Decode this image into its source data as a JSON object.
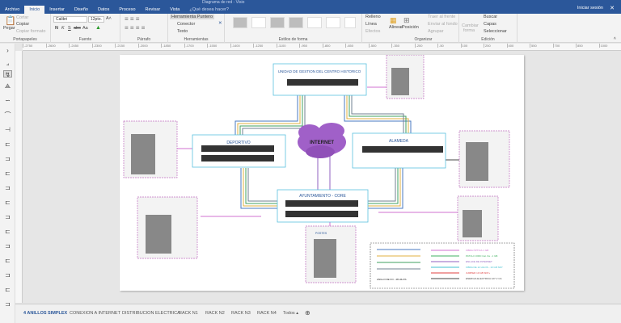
{
  "window": {
    "title": "Diagrama de red - Visio",
    "signin": "Iniciar sesión"
  },
  "tabs": [
    "Archivo",
    "Inicio",
    "Insertar",
    "Diseño",
    "Datos",
    "Proceso",
    "Revisar",
    "Vista"
  ],
  "tell_me": "¿Qué desea hacer?",
  "ribbon": {
    "clipboard": {
      "paste": "Pegar",
      "cut": "Cortar",
      "copy": "Copiar",
      "format_painter": "Copiar formato",
      "label": "Portapapeles"
    },
    "font": {
      "name": "Calibri",
      "size": "12pto.",
      "bold": "N",
      "italic": "K",
      "underline": "S",
      "strike": "abc",
      "case": "Aa",
      "label": "Fuente"
    },
    "paragraph": {
      "label": "Párrafo"
    },
    "tools": {
      "pointer": "Herramienta Puntero",
      "connector": "Conector",
      "text": "Texto",
      "label": "Herramientas"
    },
    "shape_styles": {
      "label": "Estilos de forma",
      "fill": "Relleno",
      "line": "Línea",
      "effects": "Efectos"
    },
    "arrange": {
      "align": "Alinear",
      "position": "Posición",
      "bring_front": "Traer al frente",
      "send_back": "Enviar al fondo",
      "group": "Agrupar",
      "label": "Organizar"
    },
    "editing": {
      "change_shape": "Cambiar forma",
      "find": "Buscar",
      "layers": "Capas",
      "select": "Seleccionar",
      "label": "Edición"
    }
  },
  "ruler": [
    "-2750",
    "-2600",
    "-2450",
    "-2300",
    "-2150",
    "-2000",
    "-1850",
    "-1700",
    "-1550",
    "-1400",
    "-1250",
    "-1100",
    "-950",
    "-800",
    "-650",
    "-500",
    "-350",
    "-200",
    "-50",
    "100",
    "250",
    "400",
    "550",
    "700",
    "850",
    "1000"
  ],
  "diagram": {
    "nodes": {
      "ugch": "UNIDAD DE GESTION DEL CENTRO HISTORICO",
      "deportivo": "DEPORTIVO",
      "alameda": "ALAMEDA",
      "internet": "INTERNET",
      "core": "AYUNTAMIENTO - CORE",
      "postes": "POSTES"
    },
    "legend": {
      "ring": "ANILLO DE FO - 48 HILOS",
      "items": [
        {
          "label": "FIBRA ÓPTICA 1 GB",
          "color": "#d070d0"
        },
        {
          "label": "PATCH CORD Cat. 6a - 1 GB",
          "color": "#40b060"
        },
        {
          "label": "ENLACE DE INTERNET",
          "color": "#9060c0"
        },
        {
          "label": "FIBRA DE 12 HILOS - 10 GB SFP",
          "color": "#40c0d0"
        },
        {
          "label": "JUMPER 10 GB SFP+",
          "color": "#e04040"
        },
        {
          "label": "ENERGIA ELECTRICA 127 V CA",
          "color": "#444444"
        }
      ],
      "ring_colors": [
        "#4a7ac0",
        "#e0b040",
        "#40a060",
        "#708090"
      ]
    }
  },
  "page_tabs": [
    "4 ANILLOS SIMPLEX",
    "CONEXION A INTERNET",
    "DISTRIBUCION ELECTRICA",
    "RACK  N1",
    "RACK N2",
    "RACK N3",
    "RACK N4",
    "Todos ▴"
  ]
}
